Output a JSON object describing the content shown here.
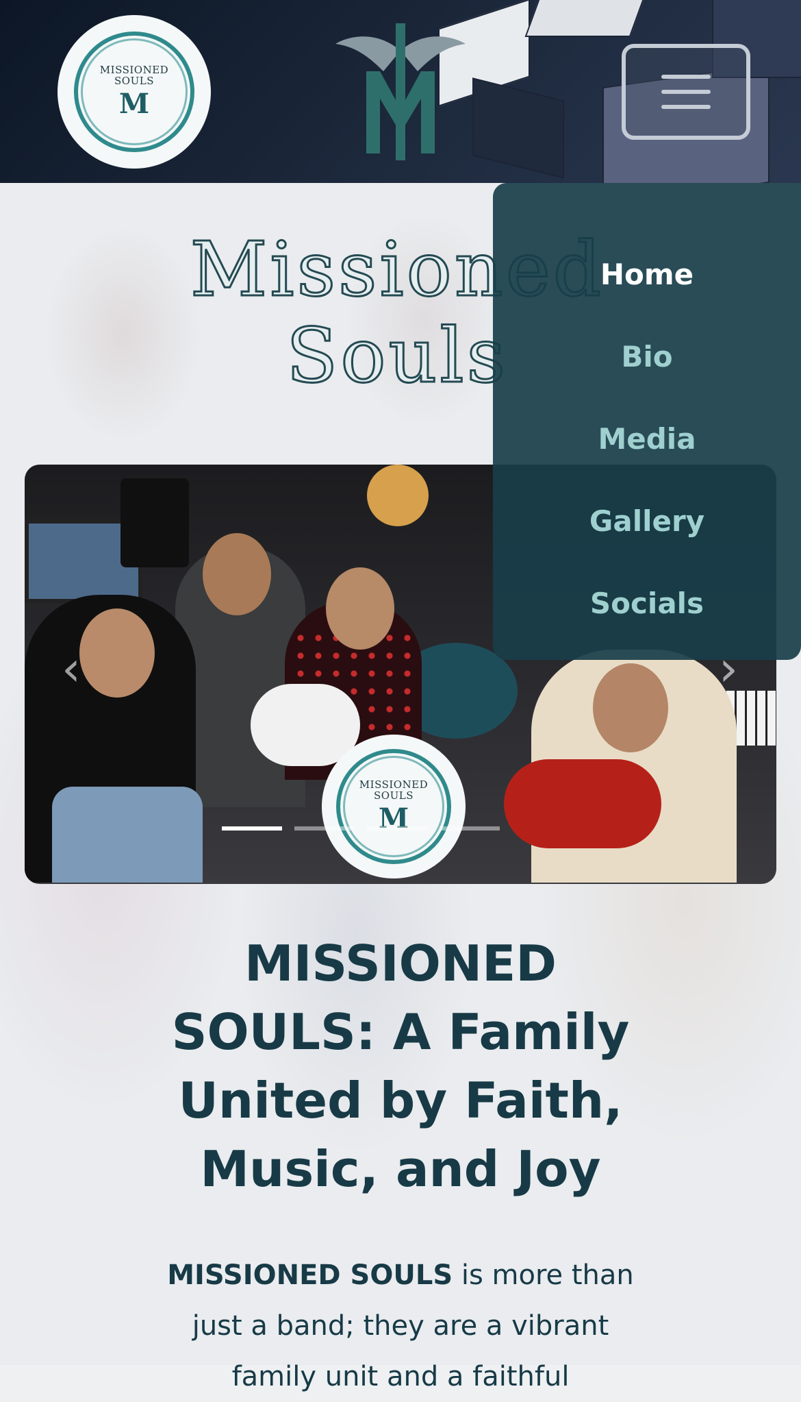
{
  "header": {
    "logo_text": "MISSIONED\nSOULS",
    "logo_mark": "M"
  },
  "nav": {
    "items": [
      {
        "label": "Home",
        "active": true
      },
      {
        "label": "Bio",
        "active": false
      },
      {
        "label": "Media",
        "active": false
      },
      {
        "label": "Gallery",
        "active": false
      },
      {
        "label": "Socials",
        "active": false
      }
    ]
  },
  "hero": {
    "title_line1": "Missioned",
    "title_line2": "Souls"
  },
  "carousel": {
    "logo_text": "MISSIONED\nSOULS",
    "logo_mark": "M",
    "prev_icon": "chevron-left-icon",
    "next_icon": "chevron-right-icon",
    "slide_count": 5,
    "active_slide": 1
  },
  "content": {
    "headline": "MISSIONED SOULS: A Family United by Faith, Music, and Joy",
    "intro_bold": "MISSIONED SOULS",
    "intro_rest": " is more than just a band; they are a vibrant family unit and a faithful"
  },
  "colors": {
    "nav_bg": "#183e4a",
    "nav_link": "#9fd0cf",
    "nav_active": "#ffffff",
    "text_dark": "#173a46"
  }
}
